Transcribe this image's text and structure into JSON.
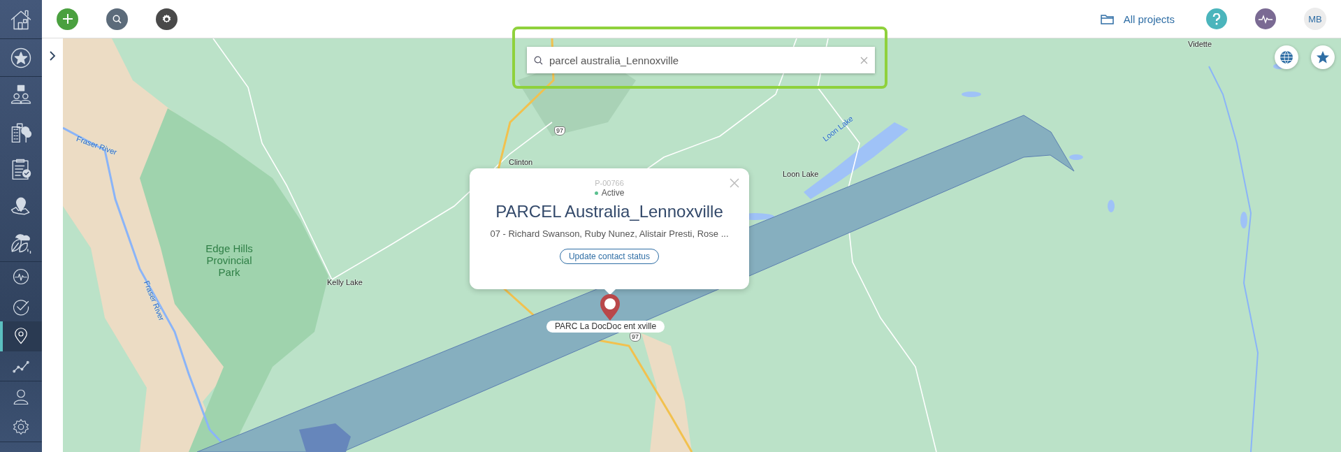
{
  "sidebar": {
    "groups": [
      {
        "items": [
          {
            "selected": false
          }
        ]
      },
      {
        "items": [
          {
            "selected": false
          }
        ]
      },
      {
        "items": [
          {
            "selected": false
          },
          {
            "selected": false
          },
          {
            "selected": false
          },
          {
            "selected": false
          },
          {
            "selected": false
          }
        ]
      },
      {
        "items": [
          {
            "selected": false
          },
          {
            "selected": false
          },
          {
            "selected": true
          },
          {
            "selected": false
          }
        ]
      },
      {
        "items": [
          {
            "selected": false
          },
          {
            "selected": false
          }
        ]
      }
    ]
  },
  "top_bar": {
    "projects_link": "All projects",
    "avatar_initials": "MB"
  },
  "search": {
    "value": "parcel australia_Lennoxville"
  },
  "map_labels": [
    {
      "text": "Clinton",
      "kind": "town"
    },
    {
      "text": "Kelly Lake",
      "kind": "town"
    },
    {
      "text": "Loon Lake",
      "kind": "town"
    },
    {
      "text": "Vidette",
      "kind": "town"
    },
    {
      "text": "Edge Hills Provincial Park",
      "kind": "park"
    },
    {
      "text": "Fraser River",
      "kind": "water"
    },
    {
      "text": "Fraser River",
      "kind": "water"
    },
    {
      "text": "Loon Lake",
      "kind": "water"
    },
    {
      "text": "97",
      "kind": "highway"
    },
    {
      "text": "97",
      "kind": "highway"
    }
  ],
  "popup": {
    "code": "P-00766",
    "status": "Active",
    "title": "PARCEL Australia_Lennoxville",
    "contacts": "07 - Richard Swanson, Ruby Nunez, Alistair Presti, Rose ...",
    "button": "Update contact status"
  },
  "marker_label": "PARC La DocDoc ent xville"
}
